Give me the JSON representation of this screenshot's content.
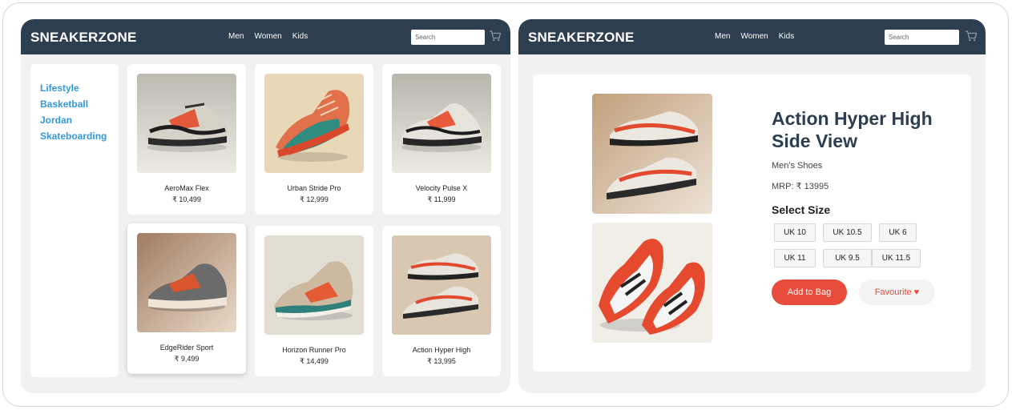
{
  "colors": {
    "navbar": "#2c3e50",
    "category_link": "#3498db",
    "add_to_bag": "#e74c3c",
    "favourite_text": "#e74c3c"
  },
  "listing": {
    "brand": "SNEAKERZONE",
    "nav": [
      "Men",
      "Women",
      "Kids"
    ],
    "search_placeholder": "Search",
    "cart_icon": "cart-icon",
    "categories": [
      "Lifestyle",
      "Basketball",
      "Jordan",
      "Skateboarding"
    ],
    "products": [
      {
        "name": "AeroMax Flex",
        "price": "₹ 10,499"
      },
      {
        "name": "Urban Stride Pro",
        "price": "₹ 12,999"
      },
      {
        "name": "Velocity Pulse X",
        "price": "₹ 11,999"
      },
      {
        "name": "EdgeRider Sport",
        "price": "₹ 9,499"
      },
      {
        "name": "Horizon Runner Pro",
        "price": "₹ 14,499"
      },
      {
        "name": "Action Hyper High",
        "price": "₹ 13,995"
      }
    ]
  },
  "detail": {
    "brand": "SNEAKERZONE",
    "nav": [
      "Men",
      "Women",
      "Kids"
    ],
    "search_placeholder": "Search",
    "cart_icon": "cart-icon",
    "title": "Action Hyper High Side View",
    "category": "Men's Shoes",
    "mrp": "MRP: ₹ 13995",
    "select_size_label": "Select Size",
    "sizes": [
      "UK 10",
      "UK 10.5",
      "UK 6",
      "UK 11",
      "UK 9.5",
      "UK 11.5"
    ],
    "add_to_bag_label": "Add to Bag",
    "favourite_label": "Favourite ♥"
  }
}
